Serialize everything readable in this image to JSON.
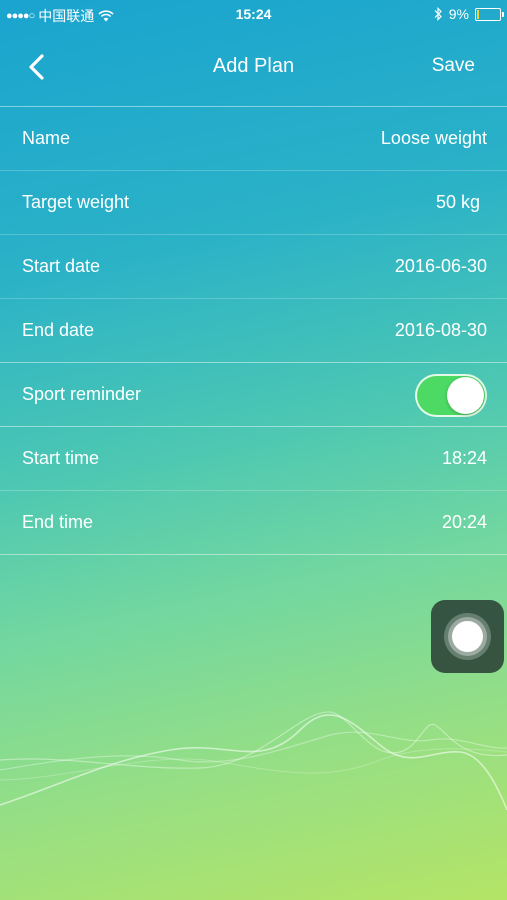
{
  "status_bar": {
    "signal": "●●●●○",
    "carrier": "中国联通",
    "time": "15:24",
    "battery": "9%",
    "battery_level": 0.09
  },
  "nav": {
    "title": "Add Plan",
    "save_label": "Save",
    "back_icon": "chevron-left-icon"
  },
  "rows": [
    {
      "label": "Name",
      "value": "Loose weight"
    },
    {
      "label": "Target weight",
      "value": "50 kg"
    },
    {
      "label": "Start date",
      "value": "2016-06-30"
    },
    {
      "label": "End date",
      "value": "2016-08-30"
    },
    {
      "label": "Sport reminder",
      "toggle_on": true
    },
    {
      "label": "Start time",
      "value": "18:24"
    },
    {
      "label": "End time",
      "value": "20:24"
    }
  ],
  "colors": {
    "toggle_on": "#4cd964",
    "battery_low": "#f2d233"
  }
}
